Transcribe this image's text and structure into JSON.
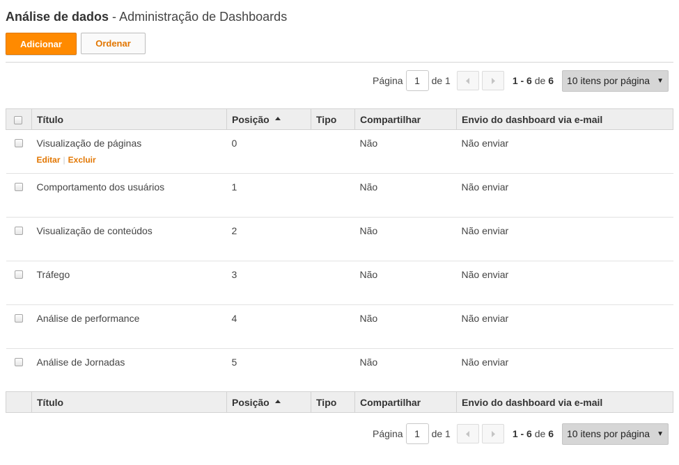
{
  "header": {
    "title_strong": "Análise de dados",
    "title_sep": " - ",
    "title_sub": "Administração de Dashboards"
  },
  "toolbar": {
    "add_label": "Adicionar",
    "order_label": "Ordenar"
  },
  "pager": {
    "page_label": "Página",
    "current_page": "1",
    "of_label": "de 1",
    "range_start_end": "1 - 6",
    "range_of": " de ",
    "total": "6",
    "per_page_selected": "10 itens por página"
  },
  "table": {
    "columns": [
      "Título",
      "Posição",
      "Tipo",
      "Compartilhar",
      "Envio do dashboard via e-mail"
    ],
    "rows": [
      {
        "title": "Visualização de páginas",
        "position": "0",
        "type": "",
        "share": "Não",
        "email": "Não enviar"
      },
      {
        "title": "Comportamento dos usuários",
        "position": "1",
        "type": "",
        "share": "Não",
        "email": "Não enviar"
      },
      {
        "title": "Visualização de conteúdos",
        "position": "2",
        "type": "",
        "share": "Não",
        "email": "Não enviar"
      },
      {
        "title": "Tráfego",
        "position": "3",
        "type": "",
        "share": "Não",
        "email": "Não enviar"
      },
      {
        "title": "Análise de performance",
        "position": "4",
        "type": "",
        "share": "Não",
        "email": "Não enviar"
      },
      {
        "title": "Análise de Jornadas",
        "position": "5",
        "type": "",
        "share": "Não",
        "email": "Não enviar"
      }
    ],
    "row_actions": {
      "edit": "Editar",
      "delete": "Excluir",
      "separator": "|"
    }
  },
  "icons": {
    "prev": "chevron-left-icon",
    "next": "chevron-right-icon",
    "sort": "sort-ascending-icon",
    "dropdown": "caret-down-icon"
  },
  "colors": {
    "accent": "#ff8a00",
    "link": "#e27600",
    "header_bg": "#eeeeee"
  }
}
